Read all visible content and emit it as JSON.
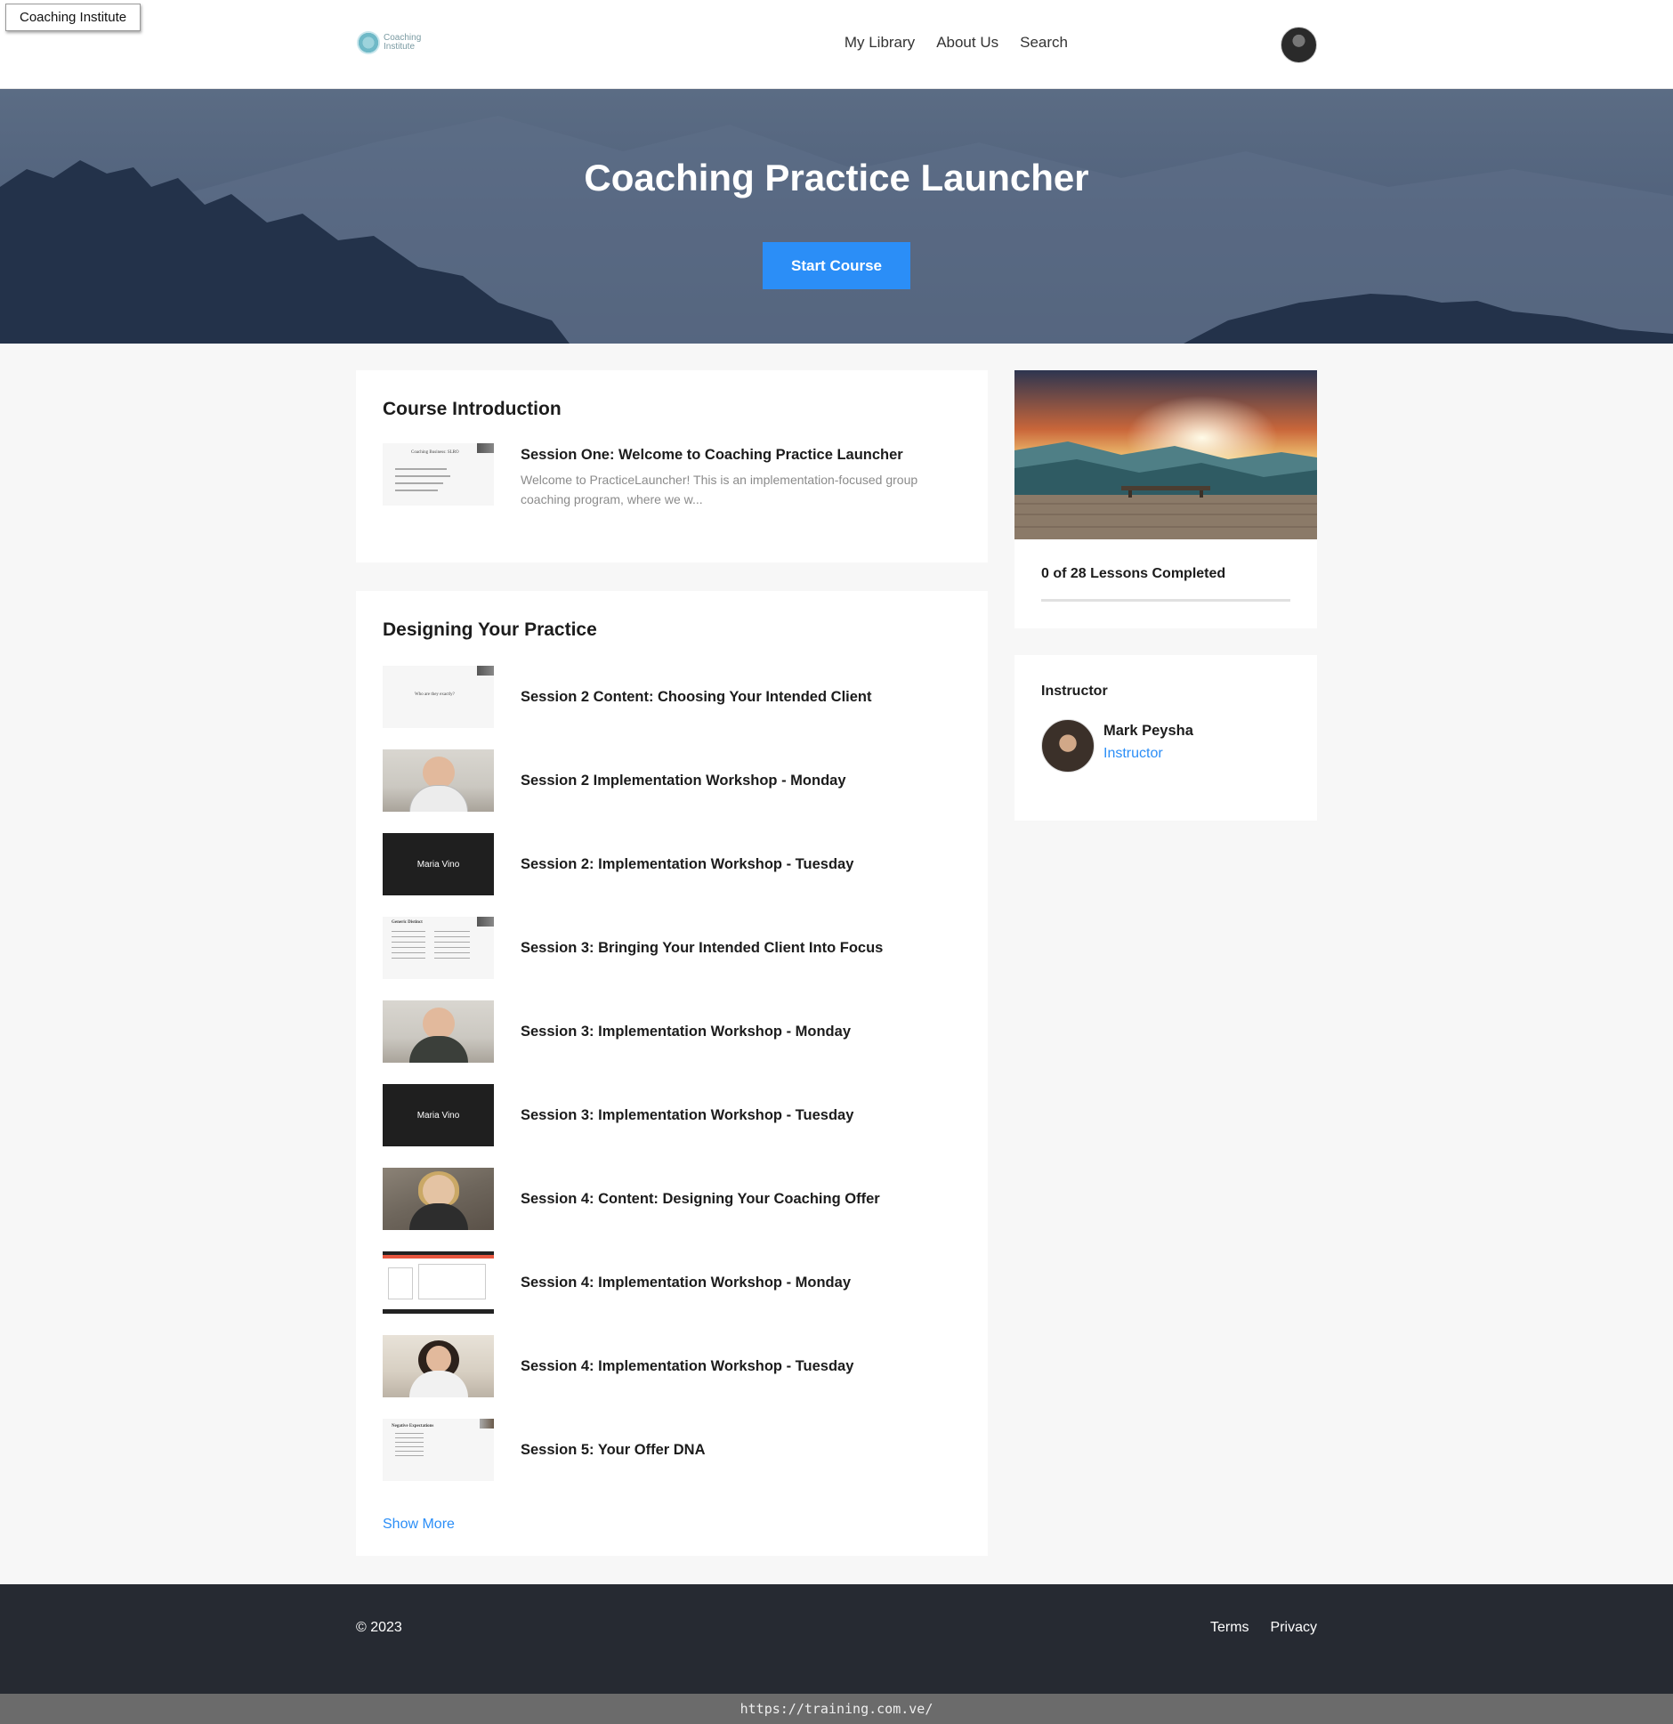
{
  "window": {
    "tab_title": "Coaching Institute"
  },
  "header": {
    "logo_text_line1": "Coaching",
    "logo_text_line2": "Institute",
    "nav": [
      "My Library",
      "About Us",
      "Search"
    ]
  },
  "hero": {
    "title": "Coaching Practice Launcher",
    "button_label": "Start Course"
  },
  "sections": [
    {
      "title": "Course Introduction",
      "lessons": [
        {
          "title": "Session One: Welcome to Coaching Practice Launcher",
          "description": "Welcome to PracticeLauncher! This is an implementation-focused group coaching program, where we w...",
          "thumb": "slide",
          "thumb_caption": "Coaching Business: SLRO"
        }
      ]
    },
    {
      "title": "Designing Your Practice",
      "lessons": [
        {
          "title": "Session 2 Content: Choosing Your Intended Client",
          "thumb": "slide",
          "thumb_caption": "Who are they exactly?"
        },
        {
          "title": "Session 2 Implementation Workshop - Monday",
          "thumb": "video-white"
        },
        {
          "title": "Session 2: Implementation Workshop - Tuesday",
          "thumb": "dark",
          "thumb_caption": "Maria Vino"
        },
        {
          "title": "Session 3: Bringing Your Intended Client Into Focus",
          "thumb": "slide",
          "thumb_caption": "Generic        Distinct"
        },
        {
          "title": "Session 3: Implementation Workshop - Monday",
          "thumb": "video"
        },
        {
          "title": "Session 3: Implementation Workshop - Tuesday",
          "thumb": "dark",
          "thumb_caption": "Maria Vino"
        },
        {
          "title": "Session 4: Content: Designing Your Coaching Offer",
          "thumb": "video-wall"
        },
        {
          "title": "Session 4: Implementation Workshop - Monday",
          "thumb": "screen"
        },
        {
          "title": "Session 4: Implementation Workshop - Tuesday",
          "thumb": "video-room"
        },
        {
          "title": "Session 5: Your Offer DNA",
          "thumb": "slide",
          "thumb_caption": "Negative Expectations"
        }
      ],
      "show_more_label": "Show More"
    }
  ],
  "progress": {
    "label": "0 of 28 Lessons Completed",
    "completed": 0,
    "total": 28
  },
  "instructor": {
    "heading": "Instructor",
    "name": "Mark Peysha",
    "role": "Instructor"
  },
  "footer": {
    "copyright": "© 2023",
    "links": [
      "Terms",
      "Privacy"
    ]
  },
  "status_url": "https://training.com.ve/",
  "colors": {
    "accent": "#2b8ef7",
    "footer_bg": "#262a32",
    "page_bg": "#f7f7f7"
  }
}
